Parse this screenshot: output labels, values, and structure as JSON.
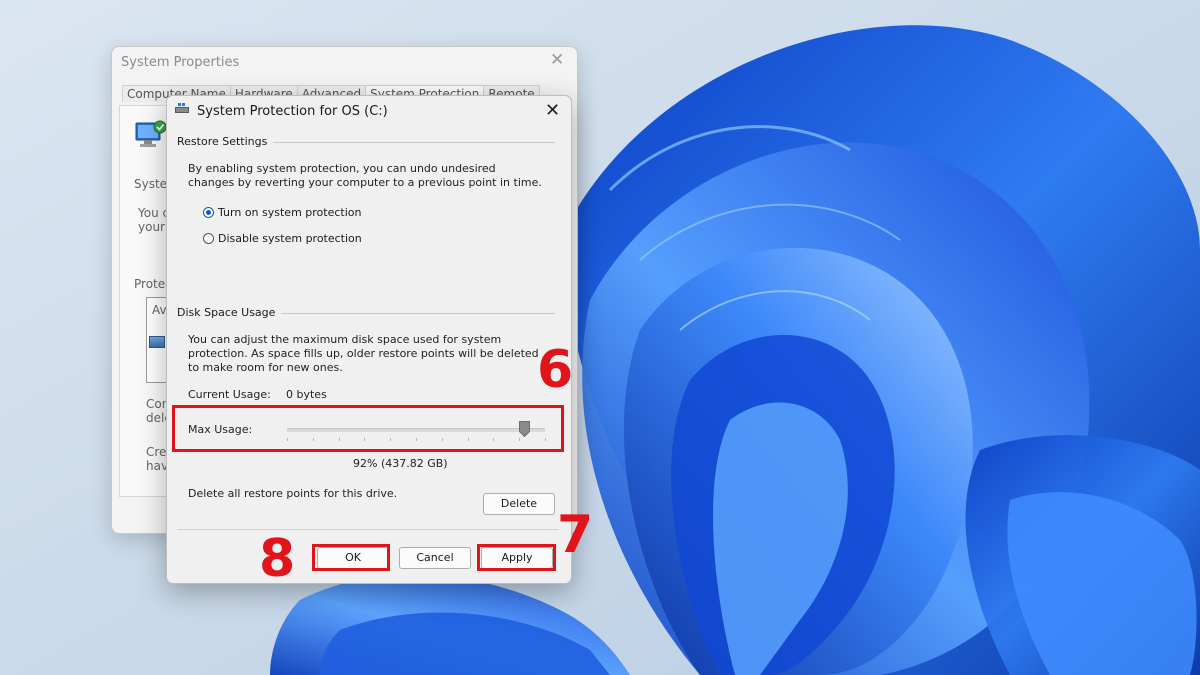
{
  "system_properties": {
    "title": "System Properties",
    "close_glyph": "✕",
    "tabs": [
      "Computer Name",
      "Hardware",
      "Advanced",
      "System Protection",
      "Remote"
    ],
    "active_tab_index": 3,
    "visible_fragments": [
      "System",
      "You c",
      "your d",
      "Protec",
      "Av",
      "Con",
      "dele",
      "Crea",
      "have"
    ]
  },
  "dialog": {
    "title": "System Protection for OS (C:)",
    "close_glyph": "✕",
    "restore_settings": {
      "heading": "Restore Settings",
      "description": "By enabling system protection, you can undo undesired changes by reverting your computer to a previous point in time.",
      "options": [
        {
          "label": "Turn on system protection",
          "checked": true
        },
        {
          "label": "Disable system protection",
          "checked": false
        }
      ]
    },
    "disk_space": {
      "heading": "Disk Space Usage",
      "description": "You can adjust the maximum disk space used for system protection. As space fills up, older restore points will be deleted to make room for new ones.",
      "current_usage_label": "Current Usage:",
      "current_usage_value": "0 bytes",
      "max_usage_label": "Max Usage:",
      "max_usage_percent": 92,
      "max_usage_readout": "92% (437.82 GB)",
      "delete_text": "Delete all restore points for this drive.",
      "delete_button": "Delete"
    },
    "buttons": {
      "ok": "OK",
      "cancel": "Cancel",
      "apply": "Apply"
    }
  },
  "annotations": {
    "step_6": "6",
    "step_7": "7",
    "step_8": "8",
    "color": "#e0141b"
  },
  "colors": {
    "accent": "#0a5cc2",
    "wallpaper_bg": "#c9d9e8",
    "bloom_blue": "#1f5fe0"
  }
}
